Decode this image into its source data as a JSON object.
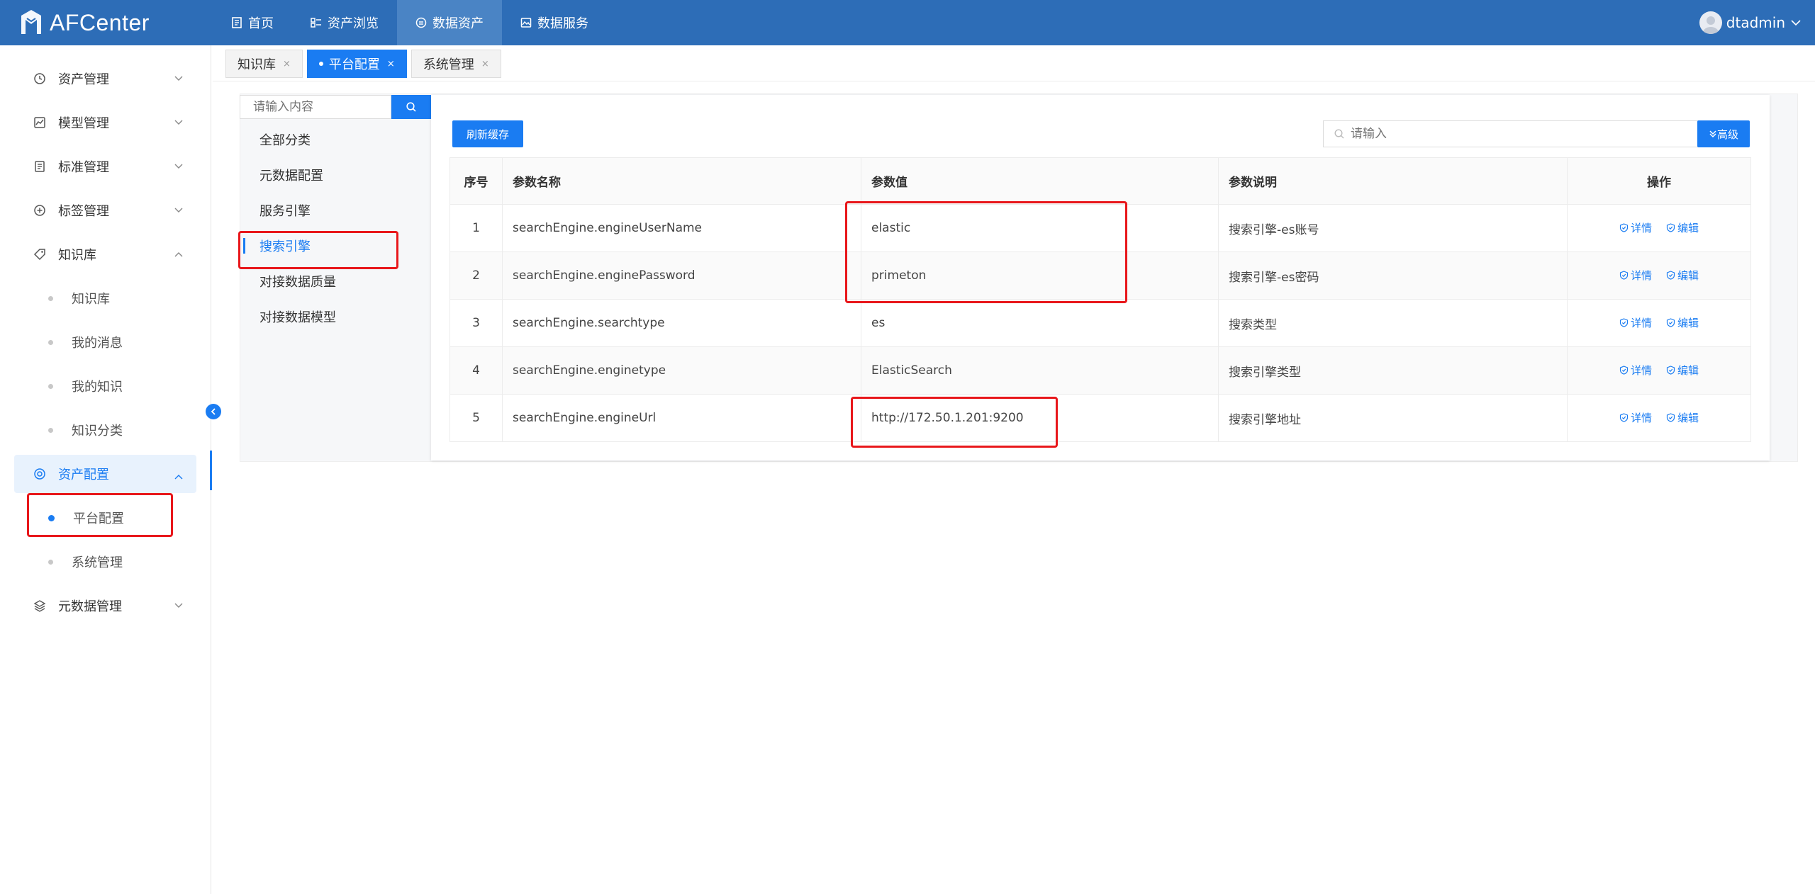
{
  "app": {
    "name": "AFCenter"
  },
  "topnav": [
    {
      "label": "首页",
      "icon": "document-icon"
    },
    {
      "label": "资产浏览",
      "icon": "grid-list-icon"
    },
    {
      "label": "数据资产",
      "icon": "database-circle-icon",
      "active": true
    },
    {
      "label": "数据服务",
      "icon": "image-icon"
    }
  ],
  "user": {
    "name": "dtadmin"
  },
  "sidebar": {
    "items": [
      {
        "label": "资产管理",
        "icon": "clock-icon"
      },
      {
        "label": "模型管理",
        "icon": "chart-icon"
      },
      {
        "label": "标准管理",
        "icon": "list-doc-icon"
      },
      {
        "label": "标签管理",
        "icon": "plus-circle-icon"
      },
      {
        "label": "知识库",
        "icon": "tag-icon",
        "expanded": true
      },
      {
        "label": "资产配置",
        "icon": "target-icon",
        "expanded": true,
        "active": true
      },
      {
        "label": "元数据管理",
        "icon": "layers-icon"
      }
    ],
    "knowledge_sub": [
      "知识库",
      "我的消息",
      "我的知识",
      "知识分类"
    ],
    "config_sub": [
      "平台配置",
      "系统管理"
    ]
  },
  "tabs": [
    {
      "label": "知识库",
      "close": "×"
    },
    {
      "label": "平台配置",
      "close": "×",
      "active": true
    },
    {
      "label": "系统管理",
      "close": "×"
    }
  ],
  "tree": {
    "placeholder": "请输入内容",
    "items": [
      "全部分类",
      "元数据配置",
      "服务引擎",
      "搜索引擎",
      "对接数据质量",
      "对接数据模型"
    ],
    "active_index": 3
  },
  "toolbar": {
    "refresh_label": "刷新缓存",
    "search_placeholder": "请输入",
    "advanced_label": "高级"
  },
  "table": {
    "headers": [
      "序号",
      "参数名称",
      "参数值",
      "参数说明",
      "操作"
    ],
    "rows": [
      {
        "no": "1",
        "name": "searchEngine.engineUserName",
        "value": "elastic",
        "desc": "搜索引擎-es账号"
      },
      {
        "no": "2",
        "name": "searchEngine.enginePassword",
        "value": "primeton",
        "desc": "搜索引擎-es密码"
      },
      {
        "no": "3",
        "name": "searchEngine.searchtype",
        "value": "es",
        "desc": "搜索类型"
      },
      {
        "no": "4",
        "name": "searchEngine.enginetype",
        "value": "ElasticSearch",
        "desc": "搜索引擎类型"
      },
      {
        "no": "5",
        "name": "searchEngine.engineUrl",
        "value": "http://172.50.1.201:9200",
        "desc": "搜索引擎地址"
      }
    ],
    "op_detail": "详情",
    "op_edit": "编辑"
  },
  "colors": {
    "primary": "#1a7cf2",
    "topbar": "#2d6db7",
    "highlight": "#e8171b"
  }
}
